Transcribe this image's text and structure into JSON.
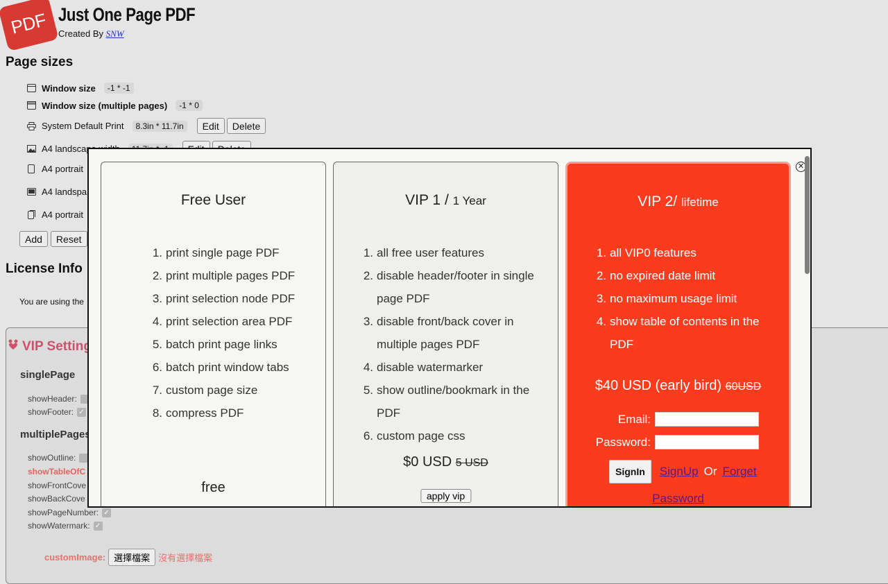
{
  "header": {
    "logo_text": "PDF",
    "title": "Just One Page PDF",
    "created_by_label": "Created By",
    "author": "SNW"
  },
  "page_sizes": {
    "title": "Page sizes",
    "items": [
      {
        "icon": "window-icon",
        "name": "Window size",
        "value": "-1 * -1",
        "bold": true
      },
      {
        "icon": "windows-stack-icon",
        "name": "Window size (multiple pages)",
        "value": "-1 * 0",
        "bold": true
      },
      {
        "icon": "printer-icon",
        "name": "System Default Print",
        "value": "8.3in * 11.7in",
        "edit": "Edit",
        "delete": "Delete"
      },
      {
        "icon": "image-icon",
        "name": "A4 landscape width",
        "value": "11.7in * -1",
        "edit": "Edit",
        "delete": "Delete"
      },
      {
        "icon": "portrait-page-icon",
        "name": "A4 portrait"
      },
      {
        "icon": "landscape-image-icon",
        "name": "A4 landspa"
      },
      {
        "icon": "portrait-pages-icon",
        "name": "A4 portrait"
      }
    ],
    "add_label": "Add",
    "reset_label": "Reset"
  },
  "license": {
    "title": "License Info",
    "text": "You are using the"
  },
  "vip_settings": {
    "title": "VIP Setting",
    "single_page": {
      "title": "singlePage",
      "options": [
        {
          "label": "showHeader:"
        },
        {
          "label": "showFooter:"
        }
      ]
    },
    "multiple_pages": {
      "title": "multiplePages",
      "options": [
        {
          "label": "showOutline:"
        },
        {
          "label": "showTableOfC",
          "highlight": true
        },
        {
          "label": "showFrontCove"
        },
        {
          "label": "showBackCove"
        },
        {
          "label": "showPageNumber:",
          "checked": true
        },
        {
          "label": "showWatermark:",
          "checked": true
        }
      ]
    },
    "custom_image_label": "customImage:",
    "choose_file_label": "選擇檔案",
    "no_file_label": "沒有選擇檔案"
  },
  "modal": {
    "free": {
      "title": "Free User",
      "features": [
        "print single page PDF",
        "print multiple pages PDF",
        "print selection node PDF",
        "print selection area PDF",
        "batch print page links",
        "batch print window tabs",
        "custom page size",
        "compress PDF"
      ],
      "price_label": "free"
    },
    "vip1": {
      "title": "VIP 1 /",
      "subtitle": "1 Year",
      "features": [
        "all free user features",
        "disable header/footer in single page PDF",
        "disable front/back cover in multiple pages PDF",
        "disable watermarker",
        "show outline/bookmark in the PDF",
        "custom page css"
      ],
      "price": "$0 USD",
      "original_price": "5 USD",
      "apply_label": "apply vip"
    },
    "vip2": {
      "title": "VIP 2/",
      "subtitle": "lifetime",
      "features": [
        "all VIP0 features",
        "no expired date limit",
        "no maximum usage limit",
        "show table of contents in the PDF"
      ],
      "price": "$40 USD (early bird)",
      "original_price": "60USD",
      "email_label": "Email:",
      "email_value": "",
      "password_label": "Password:",
      "password_value": "",
      "signin_label": "SignIn",
      "signup_label": "SignUp",
      "or_label": "Or",
      "forget_label": "Forget",
      "password_link_label": "Password"
    },
    "accent_color": "#fb3b1e"
  }
}
